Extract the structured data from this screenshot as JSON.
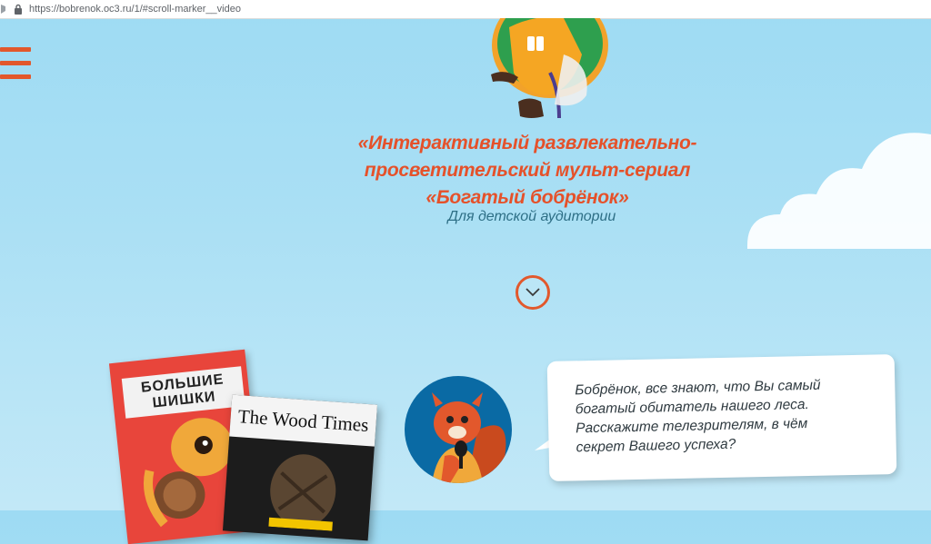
{
  "browser": {
    "url": "https://bobrenok.oc3.ru/1/#scroll-marker__video"
  },
  "hero": {
    "title_line1": "«Интерактивный развлекательно-",
    "title_line2": "просветительский мульт-сериал",
    "title_line3": "«Богатый бобрёнок»",
    "subtitle": "Для детской аудитории"
  },
  "magazines": {
    "red_title_line1": "БОЛЬШИЕ",
    "red_title_line2": "ШИШКИ",
    "black_title": "The Wood Times"
  },
  "dialog": {
    "line1": "Бобрёнок, все знают, что Вы самый",
    "line2": "богатый обитатель нашего леса.",
    "line3": "Расскажите телезрителям, в чём",
    "line4": "секрет Вашего успеха?"
  },
  "icons": {
    "menu": "hamburger-icon",
    "scroll": "chevron-down-icon",
    "lock": "lock-icon"
  },
  "colors": {
    "accent": "#e2582c",
    "subtitle": "#2e6f86",
    "sky": "#a9dff4"
  }
}
